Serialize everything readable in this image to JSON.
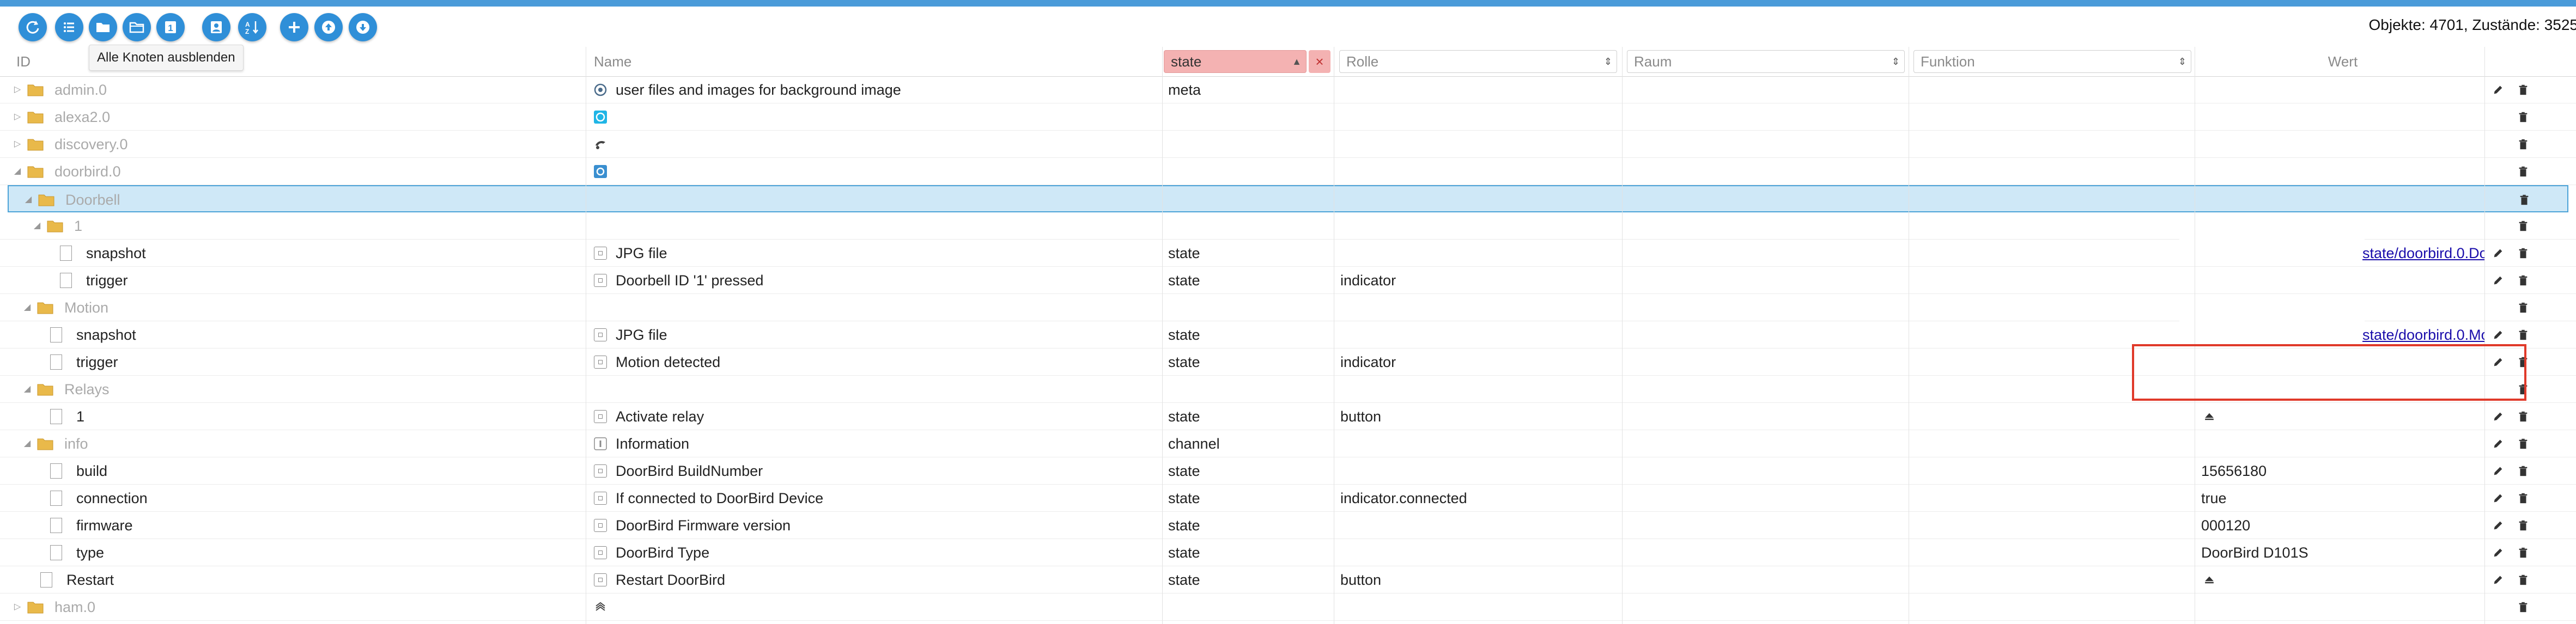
{
  "toolbar": {
    "buttons": [
      {
        "name": "refresh-button",
        "icon": "refresh-icon"
      },
      {
        "name": "list-view-button",
        "icon": "list-icon"
      },
      {
        "name": "folder-collapse-button",
        "icon": "folder-icon"
      },
      {
        "name": "folder-expand-button",
        "icon": "folder-open-icon"
      },
      {
        "name": "show-first-button",
        "icon": "number-one-icon"
      },
      {
        "name": "user-button",
        "icon": "user-icon"
      },
      {
        "name": "sort-az-button",
        "icon": "sort-az-icon"
      },
      {
        "name": "add-button",
        "icon": "plus-icon"
      },
      {
        "name": "upload-button",
        "icon": "upload-icon"
      },
      {
        "name": "download-button",
        "icon": "download-icon"
      }
    ],
    "tooltip": "Alle Knoten ausblenden",
    "counts": "Objekte: 4701, Zustände: 3525"
  },
  "columns": {
    "id": "ID",
    "name": "Name",
    "type_filter": "state",
    "role": "Rolle",
    "room": "Raum",
    "function": "Funktion",
    "value": "Wert"
  },
  "rows": [
    {
      "id": "admin.0",
      "kind": "folder",
      "level": 0,
      "expanded": false,
      "grey": true,
      "name": "user files and images for background image",
      "name_icon": "admin-icon",
      "type": "meta",
      "role": "",
      "value": ""
    },
    {
      "id": "alexa2.0",
      "kind": "folder",
      "level": 0,
      "expanded": false,
      "grey": true,
      "name": "",
      "name_icon": "alexa-icon",
      "type": "",
      "role": "",
      "value": ""
    },
    {
      "id": "discovery.0",
      "kind": "folder",
      "level": 0,
      "expanded": false,
      "grey": true,
      "name": "",
      "name_icon": "discovery-icon",
      "type": "",
      "role": "",
      "value": ""
    },
    {
      "id": "doorbird.0",
      "kind": "folder",
      "level": 0,
      "expanded": true,
      "grey": true,
      "name": "",
      "name_icon": "doorbird-icon",
      "type": "",
      "role": "",
      "value": ""
    },
    {
      "id": "Doorbell",
      "kind": "folder",
      "level": 1,
      "expanded": true,
      "grey": true,
      "selected": true,
      "name": "",
      "type": "",
      "role": "",
      "value": ""
    },
    {
      "id": "1",
      "kind": "folder",
      "level": 2,
      "expanded": true,
      "grey": true,
      "name": "",
      "type": "",
      "role": "",
      "value": ""
    },
    {
      "id": "snapshot",
      "kind": "file",
      "level": 3,
      "name": "JPG file",
      "name_icon": "state-icon",
      "type": "state",
      "role": "",
      "value": "state/doorbird.0.Do"
    },
    {
      "id": "trigger",
      "kind": "file",
      "level": 3,
      "name": "Doorbell ID '1' pressed",
      "name_icon": "state-icon",
      "type": "state",
      "role": "indicator",
      "value": ""
    },
    {
      "id": "Motion",
      "kind": "folder",
      "level": 1,
      "expanded": true,
      "grey": true,
      "name": "",
      "type": "",
      "role": "",
      "value": ""
    },
    {
      "id": "snapshot",
      "kind": "file",
      "level": 2,
      "name": "JPG file",
      "name_icon": "state-icon",
      "type": "state",
      "role": "",
      "value": "state/doorbird.0.Mo"
    },
    {
      "id": "trigger",
      "kind": "file",
      "level": 2,
      "name": "Motion detected",
      "name_icon": "state-icon",
      "type": "state",
      "role": "indicator",
      "value": ""
    },
    {
      "id": "Relays",
      "kind": "folder",
      "level": 1,
      "expanded": true,
      "grey": true,
      "name": "",
      "type": "",
      "role": "",
      "value": ""
    },
    {
      "id": "1",
      "kind": "file",
      "level": 2,
      "name": "Activate relay",
      "name_icon": "state-icon",
      "type": "state",
      "role": "button",
      "value": "",
      "value_icon": "eject-icon"
    },
    {
      "id": "info",
      "kind": "folder",
      "level": 1,
      "expanded": true,
      "grey": true,
      "name": "Information",
      "name_icon": "channel-icon",
      "type": "channel",
      "role": "",
      "value": ""
    },
    {
      "id": "build",
      "kind": "file",
      "level": 2,
      "name": "DoorBird BuildNumber",
      "name_icon": "state-icon",
      "type": "state",
      "role": "",
      "value": "15656180"
    },
    {
      "id": "connection",
      "kind": "file",
      "level": 2,
      "name": "If connected to DoorBird Device",
      "name_icon": "state-icon",
      "type": "state",
      "role": "indicator.connected",
      "value": "true"
    },
    {
      "id": "firmware",
      "kind": "file",
      "level": 2,
      "name": "DoorBird Firmware version",
      "name_icon": "state-icon",
      "type": "state",
      "role": "",
      "value": "000120"
    },
    {
      "id": "type",
      "kind": "file",
      "level": 2,
      "name": "DoorBird Type",
      "name_icon": "state-icon",
      "type": "state",
      "role": "",
      "value": "DoorBird D101S"
    },
    {
      "id": "Restart",
      "kind": "file",
      "level": 1,
      "name": "Restart DoorBird",
      "name_icon": "state-icon",
      "type": "state",
      "role": "button",
      "value": "",
      "value_icon": "eject-icon"
    },
    {
      "id": "ham.0",
      "kind": "folder",
      "level": 0,
      "expanded": false,
      "grey": true,
      "name": "",
      "name_icon": "ham-icon",
      "type": "",
      "role": "",
      "value": ""
    }
  ],
  "colors": {
    "accent": "#2f8fd8",
    "filter_active": "#f4b2b2",
    "selection": "#cfe8f7",
    "highlight_box": "#e03a2a"
  }
}
